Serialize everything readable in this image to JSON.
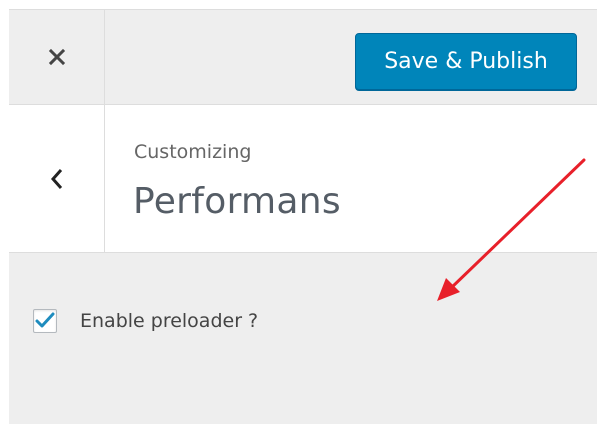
{
  "header": {
    "close_icon": "close-icon",
    "publish_label": "Save & Publish"
  },
  "panel": {
    "back_icon": "chevron-left-icon",
    "customizing_label": "Customizing",
    "section_title": "Performans"
  },
  "options": {
    "preloader": {
      "label": "Enable preloader ?",
      "checked": true
    }
  },
  "colors": {
    "primary_button": "#0085ba",
    "checkmark": "#1e8cbe",
    "annotation_arrow": "#e8202a"
  }
}
